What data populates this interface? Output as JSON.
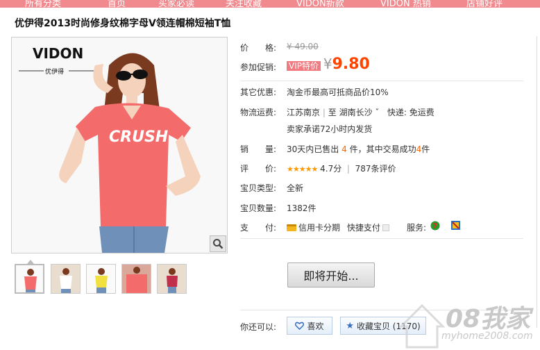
{
  "nav": {
    "items": [
      "所有分类",
      "首页",
      "买家必读",
      "关注收藏",
      "VIDON新款",
      "VIDON 热销",
      "店铺好评"
    ]
  },
  "product": {
    "title": "优伊得2013时尚修身纹棉字母V领连帽棉短袖T恤",
    "brand_logo_text": "VIDON",
    "brand_cn": "优伊得",
    "shirt_text": "CRUSH"
  },
  "props": {
    "price_label": "价　　格:",
    "price_old": "¥ 49.00",
    "promo_label": "参加促销:",
    "vip_tag": "VIP特价",
    "yen": "¥",
    "price_new": "9.80",
    "other_label": "其它优惠:",
    "other_value": "淘金币最高可抵商品价10%",
    "ship_label": "物流运费:",
    "ship_from": "江苏南京",
    "ship_to_prefix": "至",
    "ship_to": "湖南长沙",
    "ship_arrow": "ˇ",
    "ship_fee": "快递: 免运费",
    "ship_promise": "卖家承诺72小时内发货",
    "sales_label": "销　　量:",
    "sales_p1": "30天内已售出",
    "sales_n1": "4",
    "sales_p2": "件，其中交易成功",
    "sales_n2": "4",
    "sales_p3": "件",
    "rating_label": "评　　价:",
    "rating_stars": "★★★★★",
    "rating_score": "4.7分",
    "rating_sep": "|",
    "rating_count": "787条评价",
    "type_label": "宝贝类型:",
    "type_value": "全新",
    "qty_label": "宝贝数量:",
    "qty_value": "1382件",
    "pay_label": "支　　付:",
    "pay_credit": "信用卡分期",
    "pay_fast": "快捷支付",
    "service_label": "服务:"
  },
  "actions": {
    "buy_soon": "即将开始...",
    "also_label": "你还可以:",
    "like": "喜欢",
    "collect": "收藏宝贝 (1170)"
  },
  "watermark": {
    "brand": "08我家",
    "url": "myhome2008.com"
  }
}
